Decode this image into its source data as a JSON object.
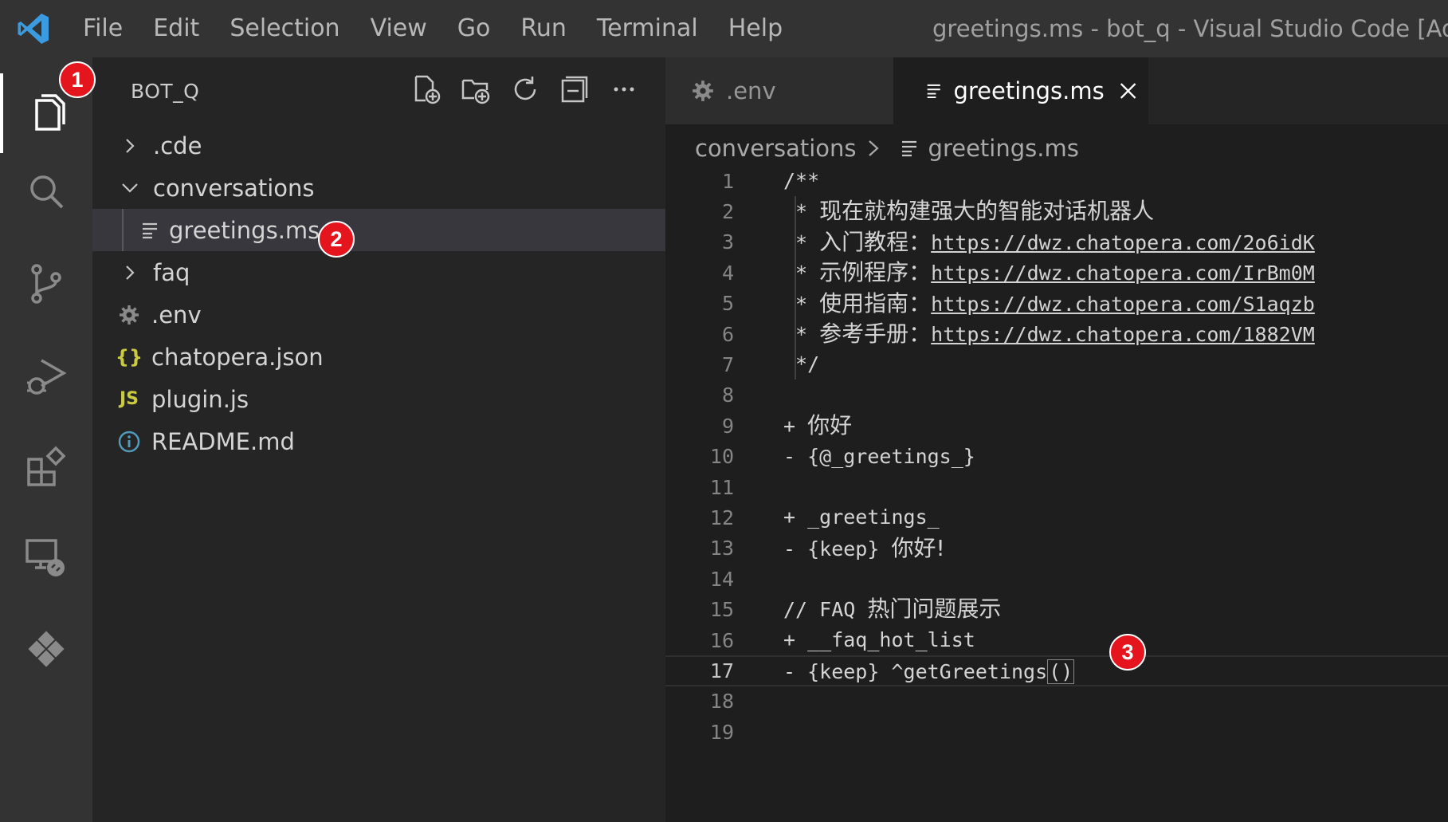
{
  "menu": [
    "File",
    "Edit",
    "Selection",
    "View",
    "Go",
    "Run",
    "Terminal",
    "Help"
  ],
  "window_title": "greetings.ms - bot_q - Visual Studio Code [Adminis",
  "badges": [
    "1",
    "2",
    "3"
  ],
  "sidebar": {
    "title": "BOT_Q",
    "tree": [
      {
        "label": ".cde",
        "type": "folder",
        "expanded": false
      },
      {
        "label": "conversations",
        "type": "folder",
        "expanded": true
      },
      {
        "label": "greetings.ms",
        "type": "file",
        "selected": true
      },
      {
        "label": "faq",
        "type": "folder",
        "expanded": false
      },
      {
        "label": ".env",
        "type": "gear"
      },
      {
        "label": "chatopera.json",
        "type": "json"
      },
      {
        "label": "plugin.js",
        "type": "js"
      },
      {
        "label": "README.md",
        "type": "info"
      }
    ],
    "json_icon": "{}",
    "js_icon": "JS"
  },
  "tabs": [
    {
      "label": ".env",
      "active": false
    },
    {
      "label": "greetings.ms",
      "active": true
    }
  ],
  "breadcrumb": {
    "folder": "conversations",
    "file": "greetings.ms"
  },
  "code_lines": [
    {
      "n": "1",
      "text": "/**"
    },
    {
      "n": "2",
      "prefix": " * ",
      "text": "现在就构建强大的智能对话机器人"
    },
    {
      "n": "3",
      "prefix": " * ",
      "label": "入门教程：",
      "link": "https://dwz.chatopera.com/2o6idK"
    },
    {
      "n": "4",
      "prefix": " * ",
      "label": "示例程序：",
      "link": "https://dwz.chatopera.com/IrBm0M"
    },
    {
      "n": "5",
      "prefix": " * ",
      "label": "使用指南：",
      "link": "https://dwz.chatopera.com/S1aqzb"
    },
    {
      "n": "6",
      "prefix": " * ",
      "label": "参考手册：",
      "link": "https://dwz.chatopera.com/1882VM"
    },
    {
      "n": "7",
      "text": " */"
    },
    {
      "n": "8",
      "text": ""
    },
    {
      "n": "9",
      "prefix": "+ ",
      "text": "你好"
    },
    {
      "n": "10",
      "text": "- {@_greetings_}"
    },
    {
      "n": "11",
      "text": ""
    },
    {
      "n": "12",
      "text": "+ _greetings_"
    },
    {
      "n": "13",
      "prefix": "- {keep} ",
      "text": "你好!"
    },
    {
      "n": "14",
      "text": ""
    },
    {
      "n": "15",
      "prefix": "// FAQ ",
      "text": "热门问题展示"
    },
    {
      "n": "16",
      "text": "+ __faq_hot_list"
    },
    {
      "n": "17",
      "prefix": "- {keep} ^getGreetings",
      "text": "()"
    },
    {
      "n": "18",
      "text": ""
    },
    {
      "n": "19",
      "text": ""
    }
  ]
}
